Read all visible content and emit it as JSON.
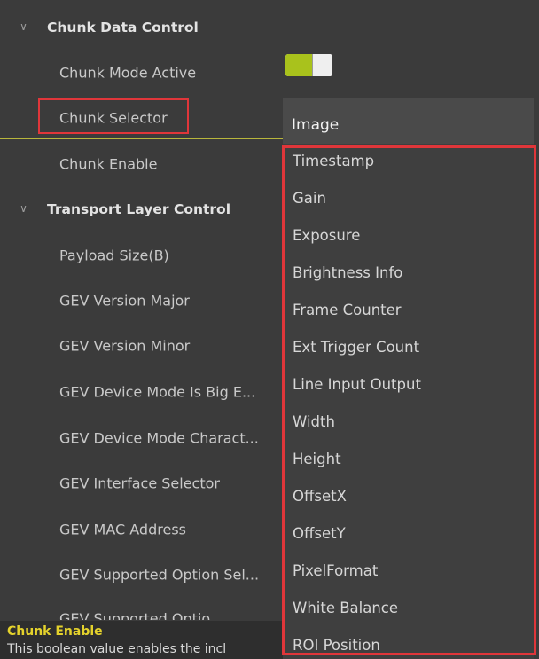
{
  "tree": {
    "chunk_section": "Chunk Data Control",
    "chunk_mode_active": "Chunk Mode Active",
    "chunk_selector": "Chunk Selector",
    "chunk_enable": "Chunk Enable",
    "transport_section": "Transport Layer Control",
    "payload_size": "Payload Size(B)",
    "gev_version_major": "GEV Version Major",
    "gev_version_minor": "GEV Version Minor",
    "gev_device_mode_big": "GEV Device Mode Is Big E...",
    "gev_device_mode_char": "GEV Device Mode Charact...",
    "gev_interface_selector": "GEV Interface Selector",
    "gev_mac_address": "GEV MAC Address",
    "gev_supported_option_sel": "GEV Supported Option Sel...",
    "gev_supported_option_partial": "GEV Supported Optio"
  },
  "toggle": {
    "state": "on",
    "accent": "#a9c21c"
  },
  "dropdown": {
    "selected": "Image",
    "options": [
      "Timestamp",
      "Gain",
      "Exposure",
      "Brightness Info",
      "Frame Counter",
      "Ext Trigger Count",
      "Line Input Output",
      "Width",
      "Height",
      "OffsetX",
      "OffsetY",
      "PixelFormat",
      "White Balance",
      "ROI Position"
    ]
  },
  "footer": {
    "title": "Chunk Enable",
    "description": "This boolean value enables the incl"
  },
  "colors": {
    "highlight": "#e0363a",
    "footer_title": "#e4d22c"
  }
}
